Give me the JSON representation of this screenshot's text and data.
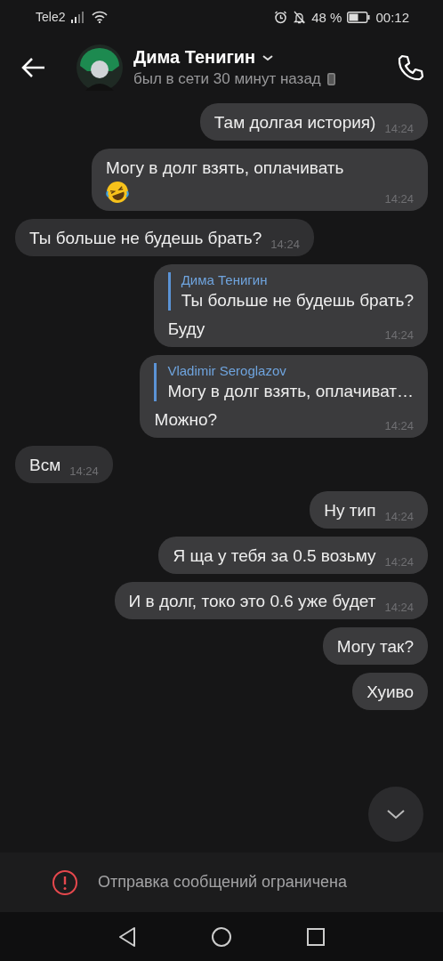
{
  "status_bar": {
    "carrier": "Tele2",
    "battery": "48 %",
    "time": "00:12"
  },
  "header": {
    "name": "Дима Тенигин",
    "last_seen": "был в сети 30 минут назад"
  },
  "messages": [
    {
      "outgoing": true,
      "text": "Там долгая история)",
      "time": "14:24"
    },
    {
      "outgoing": true,
      "text": "Могу в долг взять, оплачивать",
      "emoji_icon": true,
      "time": "14:24"
    },
    {
      "outgoing": false,
      "text": "Ты больше не будешь брать?",
      "time": "14:24"
    },
    {
      "outgoing": true,
      "reply": {
        "author": "Дима Тенигин",
        "text": "Ты больше не будешь брать?"
      },
      "text": "Буду",
      "time": "14:24"
    },
    {
      "outgoing": true,
      "reply": {
        "author": "Vladimir Seroglazov",
        "text": "Могу в долг взять, оплачиват…"
      },
      "text": "Можно?",
      "time": "14:24"
    },
    {
      "outgoing": false,
      "text": "Всм",
      "time": "14:24"
    },
    {
      "outgoing": true,
      "text": "Ну тип",
      "time": "14:24"
    },
    {
      "outgoing": true,
      "text": "Я ща у тебя за 0.5 возьму",
      "time": "14:24"
    },
    {
      "outgoing": true,
      "text": "И в долг, токо это 0.6 уже будет",
      "time": "14:24"
    },
    {
      "outgoing": true,
      "text": "Могу так?"
    },
    {
      "outgoing": true,
      "text": "Хуиво"
    }
  ],
  "footer": {
    "notice": "Отправка сообщений ограничена"
  }
}
